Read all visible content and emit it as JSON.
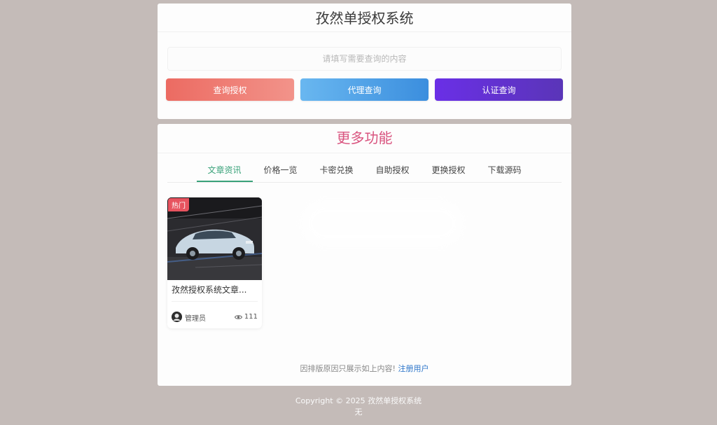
{
  "search_card": {
    "title": "孜然单授权系统",
    "search_placeholder": "请填写需要查询的内容",
    "buttons": {
      "query_license": "查询授权",
      "agent_query": "代理查询",
      "certify_query": "认证查询"
    }
  },
  "feature_card": {
    "title": "更多功能",
    "tabs": [
      "文章资讯",
      "价格一览",
      "卡密兑换",
      "自助授权",
      "更换授权",
      "下载源码"
    ],
    "article": {
      "badge": "热门",
      "title": "孜然授权系统文章...",
      "author": "管理员",
      "views": "111"
    },
    "notice": {
      "text": "因排版原因只展示如上内容!",
      "link": "注册用户"
    }
  },
  "footer": {
    "copyright": "Copyright © 2025 孜然单授权系统",
    "extra": "无"
  },
  "colors": {
    "accent_tab": "#3aa27a",
    "feature_title": "#d9547f",
    "hot_badge": "#e7535f",
    "link": "#2a74c9"
  }
}
